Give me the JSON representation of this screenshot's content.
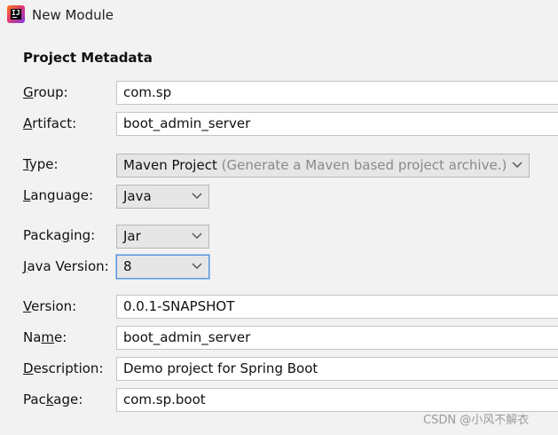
{
  "window": {
    "title": "New Module",
    "icon": "intellij-idea-icon",
    "icon_glyph": "IJ"
  },
  "section_title": "Project Metadata",
  "fields": {
    "group": {
      "label_pre": "",
      "label_u": "G",
      "label_post": "roup:",
      "value": "com.sp"
    },
    "artifact": {
      "label_pre": "",
      "label_u": "A",
      "label_post": "rtifact:",
      "value": "boot_admin_server"
    },
    "type": {
      "label_pre": "",
      "label_u": "T",
      "label_post": "ype:",
      "value": "Maven Project",
      "hint": "(Generate a Maven based project archive.)"
    },
    "language": {
      "label_pre": "",
      "label_u": "L",
      "label_post": "anguage:",
      "value": "Java"
    },
    "packaging": {
      "label_pre": "Packa",
      "label_u": "g",
      "label_post": "ing:",
      "value": "Jar"
    },
    "java_version": {
      "label_pre": "",
      "label_u": "J",
      "label_post": "ava Version:",
      "value": "8"
    },
    "version": {
      "label_pre": "",
      "label_u": "V",
      "label_post": "ersion:",
      "value": "0.0.1-SNAPSHOT"
    },
    "name": {
      "label_pre": "Na",
      "label_u": "m",
      "label_post": "e:",
      "value": "boot_admin_server"
    },
    "description": {
      "label_pre": "",
      "label_u": "D",
      "label_post": "escription:",
      "value": "Demo project for Spring Boot"
    },
    "package": {
      "label_pre": "Pac",
      "label_u": "k",
      "label_post": "age:",
      "value": "com.sp.boot"
    }
  },
  "watermark": "CSDN @小风不解衣",
  "colors": {
    "background": "#f2f2f2",
    "focus_border": "#5a97d9",
    "hint_text": "#8a8a8a"
  }
}
